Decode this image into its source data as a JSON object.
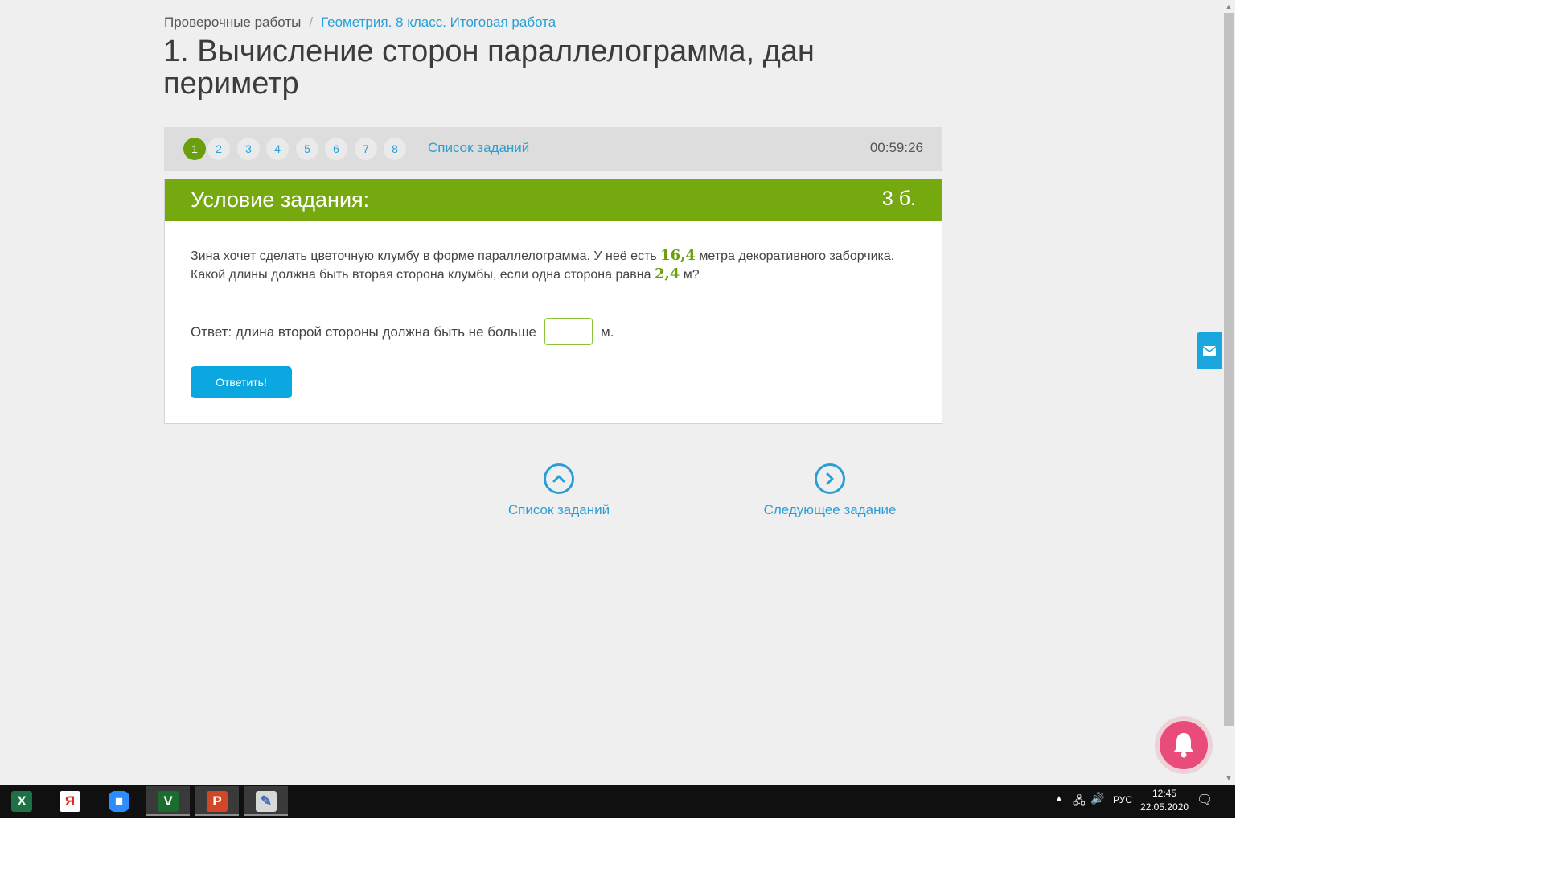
{
  "breadcrumb": {
    "root": "Проверочные работы",
    "separator": "/",
    "current": "Геометрия. 8 класс. Итоговая работа"
  },
  "page_title": "1. Вычисление сторон параллелограмма, дан периметр",
  "task_nav": {
    "numbers": [
      "1",
      "2",
      "3",
      "4",
      "5",
      "6",
      "7",
      "8"
    ],
    "active": "1",
    "list_link": "Список заданий",
    "timer": "00:59:26"
  },
  "card": {
    "header": "Условие задания:",
    "points": "3 б.",
    "text_part1": "Зина хочет сделать цветочную клумбу в форме параллелограмма. У неё есть",
    "value1": "16,4",
    "text_part2": "метра декоративного заборчика.",
    "text_part3": "Какой длины должна быть вторая сторона клумбы, если одна сторона равна",
    "value2": "2,4",
    "text_part4": "м?",
    "answer_label": "Ответ: длина второй стороны должна быть не больше",
    "answer_value": "",
    "answer_unit": "м.",
    "submit_label": "Ответить!"
  },
  "bottom_nav": {
    "list_label": "Список заданий",
    "next_label": "Следующее задание"
  },
  "taskbar": {
    "apps": [
      "excel-icon",
      "yandex-browser-icon",
      "zoom-icon",
      "vim-icon",
      "powerpoint-icon",
      "paint-icon"
    ],
    "language": "РУС",
    "time": "12:45",
    "date": "22.05.2020"
  },
  "colors": {
    "accent_green": "#76a80f",
    "link_blue": "#2a9fd6",
    "button_blue": "#0aa7e0",
    "bell_pink": "#ea4c79"
  }
}
